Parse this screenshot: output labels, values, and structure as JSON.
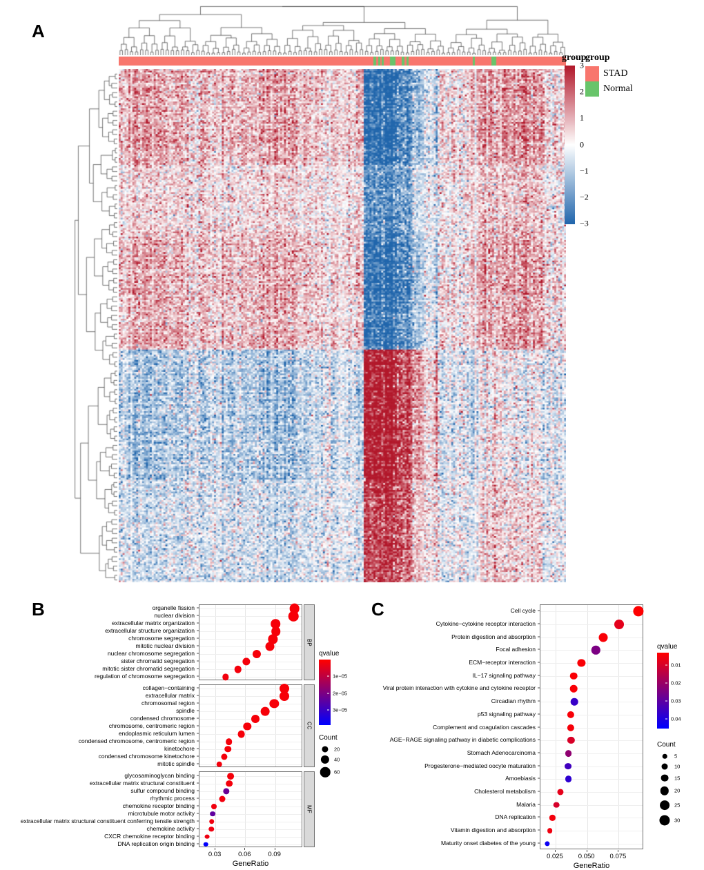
{
  "figure": {
    "panels": [
      {
        "letter": "A"
      },
      {
        "letter": "B"
      },
      {
        "letter": "C"
      }
    ]
  },
  "panelA": {
    "letter": "A",
    "type": "heatmap",
    "scale_legend": {
      "title": "group",
      "ticks": [
        "3",
        "2",
        "1",
        "0",
        "-1",
        "-2",
        "-3"
      ],
      "domain": [
        -3,
        3
      ],
      "low_color": "#2166ac",
      "mid_color": "#ffffff",
      "high_color": "#b2182b"
    },
    "group_legend": {
      "title": "group",
      "items": [
        {
          "label": "STAD",
          "color": "#f8766d"
        },
        {
          "label": "Normal",
          "color": "#68c46a"
        }
      ]
    },
    "annotation_bar": {
      "default_group": "STAD",
      "normal_segments": [
        [
          0.57,
          0.0068
        ],
        [
          0.581,
          0.0046
        ],
        [
          0.588,
          0.0046
        ],
        [
          0.606,
          0.012
        ],
        [
          0.632,
          0.0058
        ],
        [
          0.644,
          0.0046
        ],
        [
          0.791,
          0.0046
        ],
        [
          0.833,
          0.011
        ]
      ]
    }
  },
  "panelB": {
    "letter": "B",
    "type": "dotplot-go",
    "xlabel": "GeneRatio",
    "x_ticks": [
      "0.03",
      "0.06",
      "0.09"
    ],
    "x_tick_values": [
      0.03,
      0.06,
      0.09
    ],
    "x_range": [
      0.014,
      0.118
    ],
    "legend": {
      "qvalue_title": "qvalue",
      "qvalue_ticks": [
        "1e-05",
        "2e-05",
        "3e-05"
      ],
      "qvalue_tick_values": [
        1e-05,
        2e-05,
        3e-05
      ],
      "qvalue_range": [
        0.0,
        3.85e-05
      ],
      "count_title": "Count",
      "count_ticks": [
        "20",
        "40",
        "60"
      ],
      "count_tick_values": [
        20,
        40,
        60
      ]
    },
    "facets": [
      {
        "name": "BP",
        "terms": [
          {
            "label": "organelle fission",
            "generatio": 0.1095,
            "qvalue": 1.2e-06,
            "count": 63
          },
          {
            "label": "nuclear division",
            "generatio": 0.1085,
            "qvalue": 1.2e-06,
            "count": 62
          },
          {
            "label": "extracellular matrix organization",
            "generatio": 0.0905,
            "qvalue": 1.3e-06,
            "count": 53
          },
          {
            "label": "extracellular structure organization",
            "generatio": 0.0907,
            "qvalue": 1.3e-06,
            "count": 53
          },
          {
            "label": "chromosome segregation",
            "generatio": 0.0878,
            "qvalue": 1.3e-06,
            "count": 50
          },
          {
            "label": "mitotic nuclear division",
            "generatio": 0.0848,
            "qvalue": 1.3e-06,
            "count": 48
          },
          {
            "label": "nuclear chromosome segregation",
            "generatio": 0.0712,
            "qvalue": 1.4e-06,
            "count": 41
          },
          {
            "label": "sister chromatid segregation",
            "generatio": 0.061,
            "qvalue": 1.5e-06,
            "count": 35
          },
          {
            "label": "mitotic sister chromatid segregation",
            "generatio": 0.0525,
            "qvalue": 1.6e-06,
            "count": 30
          },
          {
            "label": "regulation of chromosome segregation",
            "generatio": 0.04,
            "qvalue": 2e-06,
            "count": 23
          }
        ]
      },
      {
        "name": "CC",
        "terms": [
          {
            "label": "collagen-containing",
            "generatio": 0.099,
            "qvalue": 1.2e-06,
            "count": 57
          },
          {
            "label": "extracellular matrix",
            "generatio": 0.099,
            "qvalue": 1.2e-06,
            "count": 57
          },
          {
            "label": "chromosomal region",
            "generatio": 0.089,
            "qvalue": 1.2e-06,
            "count": 51
          },
          {
            "label": "spindle",
            "generatio": 0.08,
            "qvalue": 1.3e-06,
            "count": 46
          },
          {
            "label": "condensed chromosome",
            "generatio": 0.07,
            "qvalue": 1.3e-06,
            "count": 40
          },
          {
            "label": "chromosome, centromeric region",
            "generatio": 0.062,
            "qvalue": 1.3e-06,
            "count": 36
          },
          {
            "label": "endoplasmic reticulum lumen",
            "generatio": 0.056,
            "qvalue": 1.4e-06,
            "count": 32
          },
          {
            "label": "condensed chromosome, centromeric region",
            "generatio": 0.0435,
            "qvalue": 1.5e-06,
            "count": 25
          },
          {
            "label": "kinetochore",
            "generatio": 0.0425,
            "qvalue": 1.5e-06,
            "count": 24
          },
          {
            "label": "condensed chromosome kinetochore",
            "generatio": 0.039,
            "qvalue": 1.6e-06,
            "count": 22
          },
          {
            "label": "mitotic spindle",
            "generatio": 0.034,
            "qvalue": 1.8e-06,
            "count": 19
          }
        ]
      },
      {
        "name": "MF",
        "terms": [
          {
            "label": "glycosaminoglycan binding",
            "generatio": 0.0455,
            "qvalue": 1.6e-06,
            "count": 26
          },
          {
            "label": "extracellular matrix structural constituent",
            "generatio": 0.044,
            "qvalue": 1.7e-06,
            "count": 25
          },
          {
            "label": "sulfur compound binding",
            "generatio": 0.0408,
            "qvalue": 2.25e-05,
            "count": 23
          },
          {
            "label": "rhythmic process",
            "generatio": 0.037,
            "qvalue": 1.9e-06,
            "count": 21
          },
          {
            "label": "chemokine receptor binding",
            "generatio": 0.0288,
            "qvalue": 2.1e-06,
            "count": 16
          },
          {
            "label": "microtubule motor activity",
            "generatio": 0.0275,
            "qvalue": 2.4e-05,
            "count": 15
          },
          {
            "label": "extracellular matrix structural constituent conferring tensile strength",
            "generatio": 0.0262,
            "qvalue": 2.3e-06,
            "count": 14
          },
          {
            "label": "chemokine activity",
            "generatio": 0.0258,
            "qvalue": 2.4e-06,
            "count": 14
          },
          {
            "label": "CXCR chemokine receptor binding",
            "generatio": 0.0215,
            "qvalue": 2.6e-06,
            "count": 11
          },
          {
            "label": "DNA replication origin binding",
            "generatio": 0.0205,
            "qvalue": 3.82e-05,
            "count": 10
          }
        ]
      }
    ]
  },
  "panelC": {
    "letter": "C",
    "type": "dotplot-kegg",
    "xlabel": "GeneRatio",
    "x_ticks": [
      "0.025",
      "0.050",
      "0.075"
    ],
    "x_tick_values": [
      0.025,
      0.05,
      0.075
    ],
    "x_range": [
      0.013,
      0.095
    ],
    "legend": {
      "qvalue_title": "qvalue",
      "qvalue_ticks": [
        "0.01",
        "0.02",
        "0.03",
        "0.04"
      ],
      "qvalue_tick_values": [
        0.01,
        0.02,
        0.03,
        0.04
      ],
      "qvalue_range": [
        0.003,
        0.045
      ],
      "count_title": "Count",
      "count_ticks": [
        "5",
        "10",
        "15",
        "20",
        "25",
        "30"
      ],
      "count_tick_values": [
        5,
        10,
        15,
        20,
        25,
        30
      ]
    },
    "terms": [
      {
        "label": "Cell cycle",
        "generatio": 0.0905,
        "qvalue": 0.0032,
        "count": 30
      },
      {
        "label": "Cytokine-cytokine receptor interaction",
        "generatio": 0.0755,
        "qvalue": 0.0075,
        "count": 25
      },
      {
        "label": "Protein digestion and absorption",
        "generatio": 0.0625,
        "qvalue": 0.004,
        "count": 21
      },
      {
        "label": "Focal adhesion",
        "generatio": 0.057,
        "qvalue": 0.0245,
        "count": 19
      },
      {
        "label": "ECM-receptor interaction",
        "generatio": 0.0455,
        "qvalue": 0.0038,
        "count": 15
      },
      {
        "label": "IL-17 signaling pathway",
        "generatio": 0.0395,
        "qvalue": 0.0038,
        "count": 13
      },
      {
        "label": "Viral protein interaction with cytokine and cytokine receptor",
        "generatio": 0.0395,
        "qvalue": 0.004,
        "count": 13
      },
      {
        "label": "Circadian  rhythm",
        "generatio": 0.0398,
        "qvalue": 0.036,
        "count": 13
      },
      {
        "label": "p53 signaling pathway",
        "generatio": 0.0368,
        "qvalue": 0.0042,
        "count": 12
      },
      {
        "label": "Complement and coagulation cascades",
        "generatio": 0.0368,
        "qvalue": 0.0045,
        "count": 12
      },
      {
        "label": "AGE-RAGE signaling pathway in diabetic complications",
        "generatio": 0.0372,
        "qvalue": 0.0095,
        "count": 12
      },
      {
        "label": "Stomach Adenocarcinoma",
        "generatio": 0.0352,
        "qvalue": 0.0215,
        "count": 11
      },
      {
        "label": "Progesterone-mediated oocyte maturation",
        "generatio": 0.0348,
        "qvalue": 0.0345,
        "count": 11
      },
      {
        "label": "Amoebiasis",
        "generatio": 0.0352,
        "qvalue": 0.0375,
        "count": 11
      },
      {
        "label": "Cholesterol metabolism",
        "generatio": 0.0288,
        "qvalue": 0.0072,
        "count": 9
      },
      {
        "label": "Malaria",
        "generatio": 0.0258,
        "qvalue": 0.0098,
        "count": 8
      },
      {
        "label": "DNA replication",
        "generatio": 0.0225,
        "qvalue": 0.0048,
        "count": 7
      },
      {
        "label": "Vitamin digestion and absorption",
        "generatio": 0.0205,
        "qvalue": 0.0055,
        "count": 6
      },
      {
        "label": "Maturity onset diabetes of the young",
        "generatio": 0.0182,
        "qvalue": 0.043,
        "count": 5
      }
    ]
  }
}
